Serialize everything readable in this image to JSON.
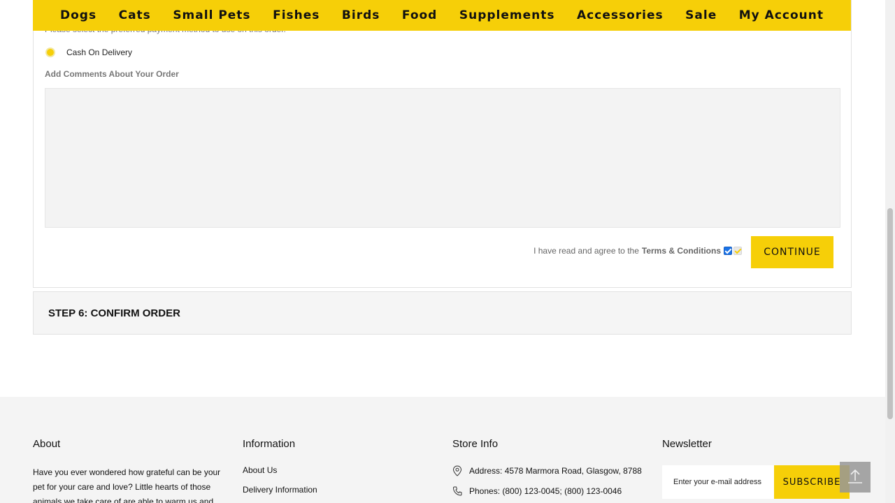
{
  "nav": {
    "items": [
      "Dogs",
      "Cats",
      "Small Pets",
      "Fishes",
      "Birds",
      "Food",
      "Supplements",
      "Accessories",
      "Sale",
      "My Account"
    ]
  },
  "payment": {
    "hint": "Please select the preferred payment method to use on this order.",
    "method_label": "Cash On Delivery",
    "comments_label": "Add Comments About Your Order",
    "comments_value": "",
    "agree_text": "I have read and agree to the",
    "terms_link": "Terms & Conditions",
    "continue_label": "CONTINUE"
  },
  "step6": {
    "title": "STEP 6: CONFIRM ORDER"
  },
  "footer": {
    "about": {
      "title": "About",
      "text": "Have you ever wondered how grateful can be your pet for your care and love? Little hearts of those animals we take care of are able to warm us and"
    },
    "information": {
      "title": "Information",
      "links": [
        "About Us",
        "Delivery Information"
      ]
    },
    "store_info": {
      "title": "Store Info",
      "address": "Address: 4578 Marmora Road, Glasgow, 8788",
      "phones": "Phones: (800) 123-0045; (800) 123-0046"
    },
    "newsletter": {
      "title": "Newsletter",
      "placeholder": "Enter your e-mail address",
      "subscribe_label": "SUBSCRIBE"
    }
  },
  "colors": {
    "accent": "#f6cf08",
    "footer_bg": "#f4f4f4"
  }
}
